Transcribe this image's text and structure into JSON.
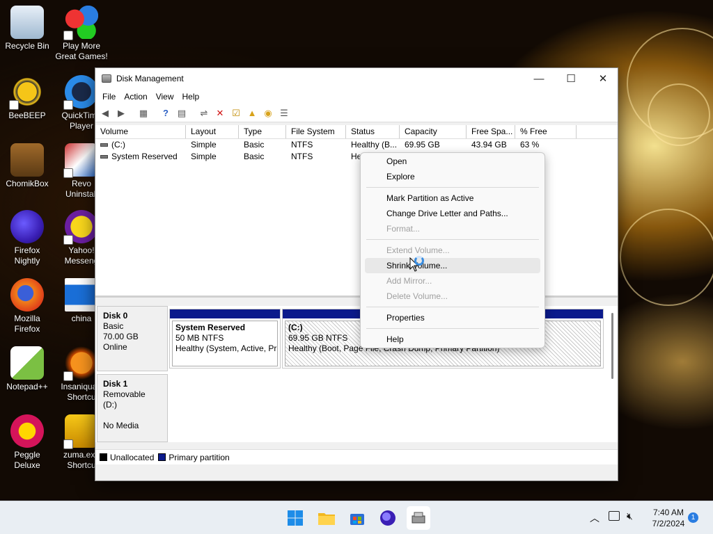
{
  "desktop": {
    "icons": [
      {
        "label": "Recycle Bin"
      },
      {
        "label": "Play More Great Games!"
      },
      {
        "label": "BeeBEEP"
      },
      {
        "label": "QuickTime Player"
      },
      {
        "label": "ChomikBox"
      },
      {
        "label": "Revo Uninstall"
      },
      {
        "label": "Firefox Nightly"
      },
      {
        "label": "Yahoo! Messeng"
      },
      {
        "label": "Mozilla Firefox"
      },
      {
        "label": "china"
      },
      {
        "label": "Notepad++"
      },
      {
        "label": "Insaniqua - Shortcu"
      },
      {
        "label": "Peggle Deluxe"
      },
      {
        "label": "zuma.exe Shortcu"
      }
    ]
  },
  "window": {
    "title": "Disk Management",
    "controls": {
      "minimize": "—",
      "maximize": "☐",
      "close": "✕"
    },
    "menu": [
      "File",
      "Action",
      "View",
      "Help"
    ],
    "toolbar_icons": [
      "back-arrow-icon",
      "forward-arrow-icon",
      "console-tree-icon",
      "help-icon",
      "properties-icon",
      "connect-icon",
      "delete-icon",
      "check-icon",
      "folder-up-icon",
      "search-folder-icon",
      "list-icon"
    ]
  },
  "volume_list": {
    "columns": [
      "Volume",
      "Layout",
      "Type",
      "File System",
      "Status",
      "Capacity",
      "Free Spa...",
      "% Free"
    ],
    "rows": [
      {
        "volume": "(C:)",
        "layout": "Simple",
        "type": "Basic",
        "fs": "NTFS",
        "status": "Healthy (B...",
        "capacity": "69.95 GB",
        "free": "43.94 GB",
        "pct": "63 %"
      },
      {
        "volume": "System Reserved",
        "layout": "Simple",
        "type": "Basic",
        "fs": "NTFS",
        "status": "He",
        "capacity": "",
        "free": "",
        "pct": ""
      }
    ]
  },
  "disks": [
    {
      "name": "Disk 0",
      "line1": "Basic",
      "line2": "70.00 GB",
      "line3": "Online"
    },
    {
      "name": "Disk 1",
      "line1": "Removable (D:)",
      "line2": "",
      "line3": "No Media"
    }
  ],
  "partitions": [
    {
      "name": "System Reserved",
      "size": "50 MB NTFS",
      "status": "Healthy (System, Active, Pri"
    },
    {
      "name": "(C:)",
      "size": "69.95 GB NTFS",
      "status": "Healthy (Boot, Page File, Crash Dump, Primary Partition)"
    }
  ],
  "legend": {
    "unallocated": "Unallocated",
    "primary": "Primary partition",
    "unallocated_color": "#000000",
    "primary_color": "#0b1a8c"
  },
  "context_menu": {
    "items": [
      {
        "label": "Open",
        "enabled": true
      },
      {
        "label": "Explore",
        "enabled": true
      },
      {
        "label": "Mark Partition as Active",
        "enabled": true
      },
      {
        "label": "Change Drive Letter and Paths...",
        "enabled": true
      },
      {
        "label": "Format...",
        "enabled": false
      },
      {
        "label": "Extend Volume...",
        "enabled": false
      },
      {
        "label": "Shrink Volume...",
        "enabled": true
      },
      {
        "label": "Add Mirror...",
        "enabled": false
      },
      {
        "label": "Delete Volume...",
        "enabled": false
      },
      {
        "label": "Properties",
        "enabled": true
      },
      {
        "label": "Help",
        "enabled": true
      }
    ]
  },
  "taskbar": {
    "apps": [
      "windows-start-icon",
      "file-explorer-icon",
      "store-icon",
      "firefox-nightly-icon",
      "disk-management-icon"
    ],
    "time": "7:40 AM",
    "date": "7/2/2024",
    "notification_count": "1"
  }
}
